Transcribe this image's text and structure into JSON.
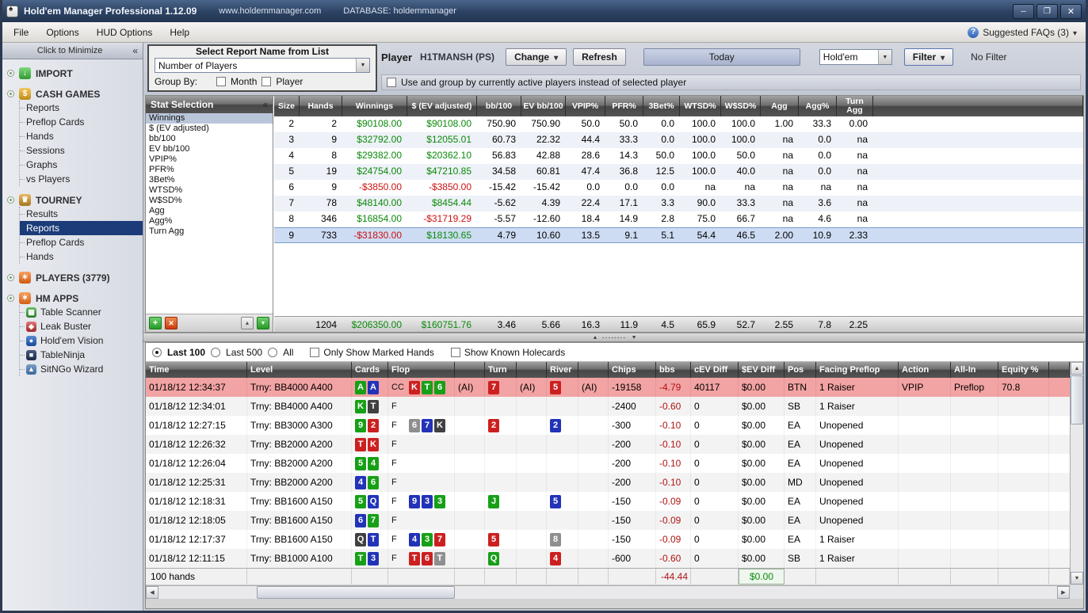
{
  "window": {
    "title": "Hold'em Manager Professional 1.12.09",
    "url": "www.holdemmanager.com",
    "database": "DATABASE: holdemmanager"
  },
  "menu": {
    "items": [
      "File",
      "Options",
      "HUD Options",
      "Help"
    ],
    "faq": "Suggested FAQs (3)"
  },
  "sidebar": {
    "minimize": "Click to Minimize",
    "sections": [
      {
        "label": "IMPORT",
        "icon": "import",
        "children": []
      },
      {
        "label": "CASH GAMES",
        "icon": "cash-games",
        "children": [
          {
            "label": "Reports"
          },
          {
            "label": "Preflop Cards"
          },
          {
            "label": "Hands"
          },
          {
            "label": "Sessions"
          },
          {
            "label": "Graphs"
          },
          {
            "label": "vs Players"
          }
        ]
      },
      {
        "label": "TOURNEY",
        "icon": "tourney",
        "children": [
          {
            "label": "Results"
          },
          {
            "label": "Reports",
            "selected": true
          },
          {
            "label": "Preflop Cards"
          },
          {
            "label": "Hands"
          }
        ]
      },
      {
        "label": "PLAYERS (3779)",
        "icon": "players",
        "children": []
      },
      {
        "label": "HM APPS",
        "icon": "hm-apps",
        "children": [
          {
            "label": "Table Scanner",
            "icon": "table-scanner"
          },
          {
            "label": "Leak Buster",
            "icon": "leak-buster"
          },
          {
            "label": "Hold'em Vision",
            "icon": "holdem-vision"
          },
          {
            "label": "TableNinja",
            "icon": "tableninja"
          },
          {
            "label": "SitNGo Wizard",
            "icon": "sitngo-wizard"
          }
        ]
      }
    ]
  },
  "report_panel": {
    "title": "Select Report Name from List",
    "dropdown_value": "Number of Players",
    "group_by_label": "Group By:",
    "checkboxes": [
      {
        "label": "Month",
        "checked": false
      },
      {
        "label": "Player",
        "checked": false
      }
    ]
  },
  "player_bar": {
    "player_label": "Player",
    "player_name": "H1TMANSH (PS)",
    "change_button": "Change",
    "refresh_button": "Refresh",
    "today_button": "Today",
    "game_type": "Hold'em",
    "filter_button": "Filter",
    "filter_status": "No Filter",
    "active_players_checkbox": "Use and group by currently active players instead of selected player"
  },
  "stat_selection": {
    "title": "Stat Selection",
    "items": [
      "Winnings",
      "$ (EV adjusted)",
      "bb/100",
      "EV bb/100",
      "VPIP%",
      "PFR%",
      "3Bet%",
      "WTSD%",
      "W$SD%",
      "Agg",
      "Agg%",
      "Turn Agg"
    ],
    "selected_index": 0
  },
  "stats_table": {
    "columns": [
      "Size",
      "Hands",
      "Winnings",
      "$ (EV adjusted)",
      "bb/100",
      "EV bb/100",
      "VPIP%",
      "PFR%",
      "3Bet%",
      "WTSD%",
      "W$SD%",
      "Agg",
      "Agg%",
      "Turn Agg"
    ],
    "rows": [
      [
        "2",
        "2",
        "$90108.00",
        "$90108.00",
        "750.90",
        "750.90",
        "50.0",
        "50.0",
        "0.0",
        "100.0",
        "100.0",
        "1.00",
        "33.3",
        "0.00"
      ],
      [
        "3",
        "9",
        "$32792.00",
        "$12055.01",
        "60.73",
        "22.32",
        "44.4",
        "33.3",
        "0.0",
        "100.0",
        "100.0",
        "na",
        "0.0",
        "na"
      ],
      [
        "4",
        "8",
        "$29382.00",
        "$20362.10",
        "56.83",
        "42.88",
        "28.6",
        "14.3",
        "50.0",
        "100.0",
        "50.0",
        "na",
        "0.0",
        "na"
      ],
      [
        "5",
        "19",
        "$24754.00",
        "$47210.85",
        "34.58",
        "60.81",
        "47.4",
        "36.8",
        "12.5",
        "100.0",
        "40.0",
        "na",
        "0.0",
        "na"
      ],
      [
        "6",
        "9",
        "-$3850.00",
        "-$3850.00",
        "-15.42",
        "-15.42",
        "0.0",
        "0.0",
        "0.0",
        "na",
        "na",
        "na",
        "na",
        "na"
      ],
      [
        "7",
        "78",
        "$48140.00",
        "$8454.44",
        "-5.62",
        "4.39",
        "22.4",
        "17.1",
        "3.3",
        "90.0",
        "33.3",
        "na",
        "3.6",
        "na"
      ],
      [
        "8",
        "346",
        "$16854.00",
        "-$31719.29",
        "-5.57",
        "-12.60",
        "18.4",
        "14.9",
        "2.8",
        "75.0",
        "66.7",
        "na",
        "4.6",
        "na"
      ],
      [
        "9",
        "733",
        "-$31830.00",
        "$18130.65",
        "4.79",
        "10.60",
        "13.5",
        "9.1",
        "5.1",
        "54.4",
        "46.5",
        "2.00",
        "10.9",
        "2.33"
      ]
    ],
    "selected_row_index": 7,
    "totals": [
      "",
      "1204",
      "$206350.00",
      "$160751.76",
      "3.46",
      "5.66",
      "16.3",
      "11.9",
      "4.5",
      "65.9",
      "52.7",
      "2.55",
      "7.8",
      "2.25"
    ]
  },
  "hands_panel": {
    "radios": [
      {
        "label": "Last 100",
        "checked": true
      },
      {
        "label": "Last 500",
        "checked": false
      },
      {
        "label": "All",
        "checked": false
      }
    ],
    "checkboxes": [
      {
        "label": "Only Show Marked Hands",
        "checked": false
      },
      {
        "label": "Show Known Holecards",
        "checked": false
      }
    ],
    "columns": [
      "Time",
      "Level",
      "Cards",
      "Flop",
      "",
      "Turn",
      "",
      "River",
      "",
      "Chips",
      "bbs",
      "cEV Diff",
      "$EV Diff",
      "Pos",
      "Facing Preflop",
      "Action",
      "All-In",
      "Equity %"
    ],
    "rows": [
      {
        "time": "01/18/12 12:34:37",
        "level": "Trny: BB4000 A400",
        "cards": [
          {
            "r": "A",
            "c": "green"
          },
          {
            "r": "A",
            "c": "blue"
          }
        ],
        "line": "CC",
        "flop": [
          {
            "r": "K",
            "c": "red"
          },
          {
            "r": "T",
            "c": "green"
          },
          {
            "r": "6",
            "c": "green"
          }
        ],
        "flop_ai": "(AI)",
        "turn": [
          {
            "r": "7",
            "c": "red"
          }
        ],
        "turn_ai": "(AI)",
        "river": [
          {
            "r": "5",
            "c": "red"
          }
        ],
        "river_ai": "(AI)",
        "chips": "-19158",
        "bbs": "-4.79",
        "cev": "40117",
        "ev": "$0.00",
        "pos": "BTN",
        "facing": "1 Raiser",
        "action": "VPIP",
        "allin": "Preflop",
        "equity": "70.8",
        "highlight": true
      },
      {
        "time": "01/18/12 12:34:01",
        "level": "Trny: BB4000 A400",
        "cards": [
          {
            "r": "K",
            "c": "green"
          },
          {
            "r": "T",
            "c": "black"
          }
        ],
        "line": "F",
        "flop": [],
        "flop_ai": "",
        "turn": [],
        "turn_ai": "",
        "river": [],
        "river_ai": "",
        "chips": "-2400",
        "bbs": "-0.60",
        "cev": "0",
        "ev": "$0.00",
        "pos": "SB",
        "facing": "1 Raiser",
        "action": "",
        "allin": "",
        "equity": "",
        "highlight": false
      },
      {
        "time": "01/18/12 12:27:15",
        "level": "Trny: BB3000 A300",
        "cards": [
          {
            "r": "9",
            "c": "green"
          },
          {
            "r": "2",
            "c": "red"
          }
        ],
        "line": "F",
        "flop": [
          {
            "r": "6",
            "c": "gray"
          },
          {
            "r": "7",
            "c": "blue"
          },
          {
            "r": "K",
            "c": "black"
          }
        ],
        "flop_ai": "",
        "turn": [
          {
            "r": "2",
            "c": "red"
          }
        ],
        "turn_ai": "",
        "river": [
          {
            "r": "2",
            "c": "blue"
          }
        ],
        "river_ai": "",
        "chips": "-300",
        "bbs": "-0.10",
        "cev": "0",
        "ev": "$0.00",
        "pos": "EA",
        "facing": "Unopened",
        "action": "",
        "allin": "",
        "equity": "",
        "highlight": false
      },
      {
        "time": "01/18/12 12:26:32",
        "level": "Trny: BB2000 A200",
        "cards": [
          {
            "r": "T",
            "c": "red"
          },
          {
            "r": "K",
            "c": "red"
          }
        ],
        "line": "F",
        "flop": [],
        "flop_ai": "",
        "turn": [],
        "turn_ai": "",
        "river": [],
        "river_ai": "",
        "chips": "-200",
        "bbs": "-0.10",
        "cev": "0",
        "ev": "$0.00",
        "pos": "EA",
        "facing": "Unopened",
        "action": "",
        "allin": "",
        "equity": "",
        "highlight": false
      },
      {
        "time": "01/18/12 12:26:04",
        "level": "Trny: BB2000 A200",
        "cards": [
          {
            "r": "5",
            "c": "green"
          },
          {
            "r": "4",
            "c": "green"
          }
        ],
        "line": "F",
        "flop": [],
        "flop_ai": "",
        "turn": [],
        "turn_ai": "",
        "river": [],
        "river_ai": "",
        "chips": "-200",
        "bbs": "-0.10",
        "cev": "0",
        "ev": "$0.00",
        "pos": "EA",
        "facing": "Unopened",
        "action": "",
        "allin": "",
        "equity": "",
        "highlight": false
      },
      {
        "time": "01/18/12 12:25:31",
        "level": "Trny: BB2000 A200",
        "cards": [
          {
            "r": "4",
            "c": "blue"
          },
          {
            "r": "6",
            "c": "green"
          }
        ],
        "line": "F",
        "flop": [],
        "flop_ai": "",
        "turn": [],
        "turn_ai": "",
        "river": [],
        "river_ai": "",
        "chips": "-200",
        "bbs": "-0.10",
        "cev": "0",
        "ev": "$0.00",
        "pos": "MD",
        "facing": "Unopened",
        "action": "",
        "allin": "",
        "equity": "",
        "highlight": false
      },
      {
        "time": "01/18/12 12:18:31",
        "level": "Trny: BB1600 A150",
        "cards": [
          {
            "r": "5",
            "c": "green"
          },
          {
            "r": "Q",
            "c": "blue"
          }
        ],
        "line": "F",
        "flop": [
          {
            "r": "9",
            "c": "blue"
          },
          {
            "r": "3",
            "c": "blue"
          },
          {
            "r": "3",
            "c": "green"
          }
        ],
        "flop_ai": "",
        "turn": [
          {
            "r": "J",
            "c": "green"
          }
        ],
        "turn_ai": "",
        "river": [
          {
            "r": "5",
            "c": "blue"
          }
        ],
        "river_ai": "",
        "chips": "-150",
        "bbs": "-0.09",
        "cev": "0",
        "ev": "$0.00",
        "pos": "EA",
        "facing": "Unopened",
        "action": "",
        "allin": "",
        "equity": "",
        "highlight": false
      },
      {
        "time": "01/18/12 12:18:05",
        "level": "Trny: BB1600 A150",
        "cards": [
          {
            "r": "6",
            "c": "blue"
          },
          {
            "r": "7",
            "c": "green"
          }
        ],
        "line": "F",
        "flop": [],
        "flop_ai": "",
        "turn": [],
        "turn_ai": "",
        "river": [],
        "river_ai": "",
        "chips": "-150",
        "bbs": "-0.09",
        "cev": "0",
        "ev": "$0.00",
        "pos": "EA",
        "facing": "Unopened",
        "action": "",
        "allin": "",
        "equity": "",
        "highlight": false
      },
      {
        "time": "01/18/12 12:17:37",
        "level": "Trny: BB1600 A150",
        "cards": [
          {
            "r": "Q",
            "c": "black"
          },
          {
            "r": "T",
            "c": "blue"
          }
        ],
        "line": "F",
        "flop": [
          {
            "r": "4",
            "c": "blue"
          },
          {
            "r": "3",
            "c": "green"
          },
          {
            "r": "7",
            "c": "red"
          }
        ],
        "flop_ai": "",
        "turn": [
          {
            "r": "5",
            "c": "red"
          }
        ],
        "turn_ai": "",
        "river": [
          {
            "r": "8",
            "c": "gray"
          }
        ],
        "river_ai": "",
        "chips": "-150",
        "bbs": "-0.09",
        "cev": "0",
        "ev": "$0.00",
        "pos": "EA",
        "facing": "1 Raiser",
        "action": "",
        "allin": "",
        "equity": "",
        "highlight": false
      },
      {
        "time": "01/18/12 12:11:15",
        "level": "Trny: BB1000 A100",
        "cards": [
          {
            "r": "T",
            "c": "green"
          },
          {
            "r": "3",
            "c": "blue"
          }
        ],
        "line": "F",
        "flop": [
          {
            "r": "T",
            "c": "red"
          },
          {
            "r": "6",
            "c": "red"
          },
          {
            "r": "T",
            "c": "gray"
          }
        ],
        "flop_ai": "",
        "turn": [
          {
            "r": "Q",
            "c": "green"
          }
        ],
        "turn_ai": "",
        "river": [
          {
            "r": "4",
            "c": "red"
          }
        ],
        "river_ai": "",
        "chips": "-600",
        "bbs": "-0.60",
        "cev": "0",
        "ev": "$0.00",
        "pos": "SB",
        "facing": "1 Raiser",
        "action": "",
        "allin": "",
        "equity": "",
        "highlight": false
      }
    ],
    "footer": {
      "hands_count": "100 hands",
      "bbs_total": "-44.44",
      "ev_total": "$0.00"
    }
  },
  "colors": {
    "card_green": "#17a017",
    "card_blue": "#2233b8",
    "card_red": "#cc2020",
    "card_black": "#404040",
    "card_gray": "#8f8f8f",
    "money_positive": "#0a8a0a",
    "money_negative": "#cc1111",
    "row_highlight": "#f2a3a3",
    "row_selected": "#cddcf3",
    "nav_selected": "#1b3c79"
  }
}
